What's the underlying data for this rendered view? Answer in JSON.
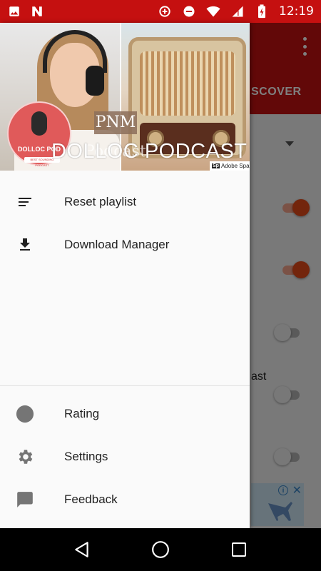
{
  "status_bar": {
    "time": "12:19",
    "left_icons": [
      "image-icon",
      "n-app-icon"
    ],
    "right_icons": [
      "data-saver-icon",
      "do-not-disturb-icon",
      "wifi-icon",
      "signal-icon",
      "battery-charging-icon"
    ],
    "color": "#c51010"
  },
  "background_app": {
    "tab_label": "SCOVER",
    "partial_text": "ast",
    "toggles": [
      {
        "state": "on"
      },
      {
        "state": "on"
      },
      {
        "state": "off"
      },
      {
        "state": "off"
      },
      {
        "state": "off"
      }
    ],
    "ad": {
      "info_glyph": "i",
      "close_glyph": "✕"
    },
    "accent": "#c51010"
  },
  "drawer": {
    "header": {
      "logo_text": "DOLLOC POD",
      "logo_subtext": "BEST SOUNDING PODCAST",
      "pnm_text": "PNM",
      "ghost_text": "Podcast",
      "title": "DOLLOC PODCAST",
      "badge_mark": "Sp",
      "badge_text": "Adobe Spark"
    },
    "top_items": [
      {
        "label": "Reset playlist",
        "icon": "playlist-icon"
      },
      {
        "label": "Download Manager",
        "icon": "download-icon"
      }
    ],
    "bottom_items": [
      {
        "label": "Rating",
        "icon": "rating-circle-icon"
      },
      {
        "label": "Settings",
        "icon": "gear-icon"
      },
      {
        "label": "Feedback",
        "icon": "feedback-icon"
      }
    ]
  },
  "nav_bar": {
    "buttons": [
      "back-icon",
      "home-icon",
      "recents-icon"
    ]
  }
}
